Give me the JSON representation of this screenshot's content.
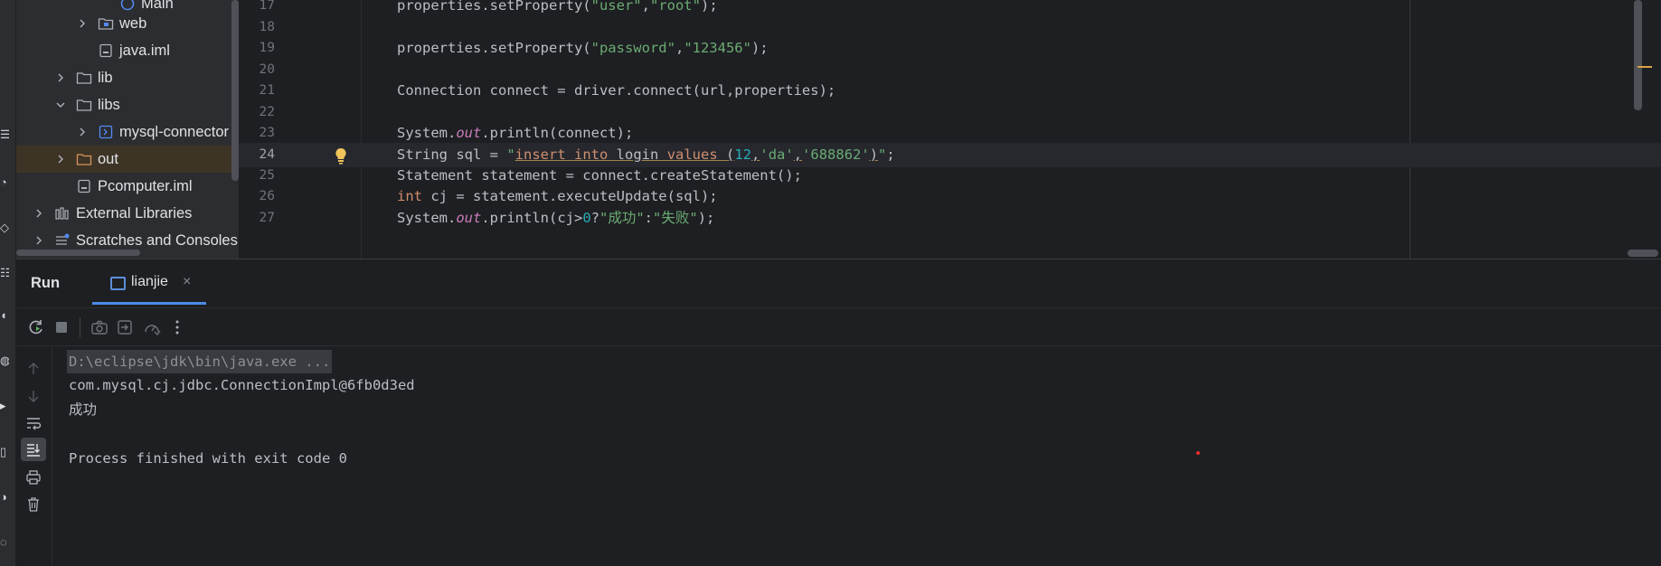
{
  "project_tree": {
    "items": [
      {
        "label": "Main",
        "type": "class"
      },
      {
        "label": "web",
        "type": "module"
      },
      {
        "label": "java.iml",
        "type": "file"
      },
      {
        "label": "lib",
        "type": "folder"
      },
      {
        "label": "libs",
        "type": "folder"
      },
      {
        "label": "mysql-connector",
        "type": "jar"
      },
      {
        "label": "out",
        "type": "folder-excluded"
      },
      {
        "label": "Pcomputer.iml",
        "type": "file"
      },
      {
        "label": "External Libraries",
        "type": "libraries"
      },
      {
        "label": "Scratches and Consoles",
        "type": "scratches"
      }
    ]
  },
  "editor": {
    "current_line": "24",
    "lines": [
      {
        "no": "17",
        "tokens": [
          [
            "properties.setProperty(",
            ""
          ],
          [
            "\"user\"",
            "str"
          ],
          [
            ",",
            ""
          ],
          [
            "\"root\"",
            "str"
          ],
          [
            ");",
            ""
          ]
        ]
      },
      {
        "no": "18",
        "tokens": []
      },
      {
        "no": "19",
        "tokens": [
          [
            "properties.setProperty(",
            ""
          ],
          [
            "\"password\"",
            "str"
          ],
          [
            ",",
            ""
          ],
          [
            "\"123456\"",
            "str"
          ],
          [
            ");",
            ""
          ]
        ]
      },
      {
        "no": "20",
        "tokens": []
      },
      {
        "no": "21",
        "tokens": [
          [
            "Connection connect = driver.connect(url,properties);",
            ""
          ]
        ]
      },
      {
        "no": "22",
        "tokens": []
      },
      {
        "no": "23",
        "tokens": [
          [
            "System.",
            ""
          ],
          [
            "out",
            "fld"
          ],
          [
            ".println(connect);",
            ""
          ]
        ]
      },
      {
        "no": "24",
        "tokens": [
          [
            "String sql = ",
            ""
          ],
          [
            "\"",
            "str"
          ],
          [
            "insert into",
            "sql"
          ],
          [
            " ",
            "sqlplain"
          ],
          [
            "login",
            "sqlplain"
          ],
          [
            " ",
            "sqlplain"
          ],
          [
            "values",
            "sql"
          ],
          [
            " (",
            "sqlplain"
          ],
          [
            "12",
            "num"
          ],
          [
            ",",
            "sqlplain"
          ],
          [
            "'da'",
            "str"
          ],
          [
            ",",
            "sqlplain"
          ],
          [
            "'688862'",
            "str"
          ],
          [
            ")",
            "sqlplain"
          ],
          [
            "\"",
            "str"
          ],
          [
            ";",
            ""
          ]
        ]
      },
      {
        "no": "25",
        "tokens": [
          [
            "Statement statement = connect.createStatement();",
            ""
          ]
        ]
      },
      {
        "no": "26",
        "tokens": [
          [
            "int",
            "kw"
          ],
          [
            " cj = statement.executeUpdate(sql);",
            ""
          ]
        ]
      },
      {
        "no": "27",
        "tokens": [
          [
            "System.",
            ""
          ],
          [
            "out",
            "fld"
          ],
          [
            ".println(cj>",
            ""
          ],
          [
            "0",
            "num"
          ],
          [
            "?",
            ""
          ],
          [
            "\"成功\"",
            "str"
          ],
          [
            ":",
            ""
          ],
          [
            "\"失败\"",
            "str"
          ],
          [
            ");",
            ""
          ]
        ]
      }
    ]
  },
  "run_panel": {
    "title": "Run",
    "tab_label": "lianjie",
    "close_glyph": "×",
    "console_lines": [
      {
        "text": "D:\\eclipse\\jdk\\bin\\java.exe ...",
        "kind": "cmd"
      },
      {
        "text": "com.mysql.cj.jdbc.ConnectionImpl@6fb0d3ed",
        "kind": "out"
      },
      {
        "text": "成功",
        "kind": "out"
      },
      {
        "text": "",
        "kind": "out"
      },
      {
        "text": "Process finished with exit code 0",
        "kind": "out"
      }
    ]
  },
  "colors": {
    "background": "#1e1f22",
    "panel": "#2b2d30",
    "string": "#6aab73",
    "keyword": "#cf8e6d",
    "number": "#2aacb8",
    "field": "#c77dbb",
    "accent": "#4a8ae8"
  }
}
